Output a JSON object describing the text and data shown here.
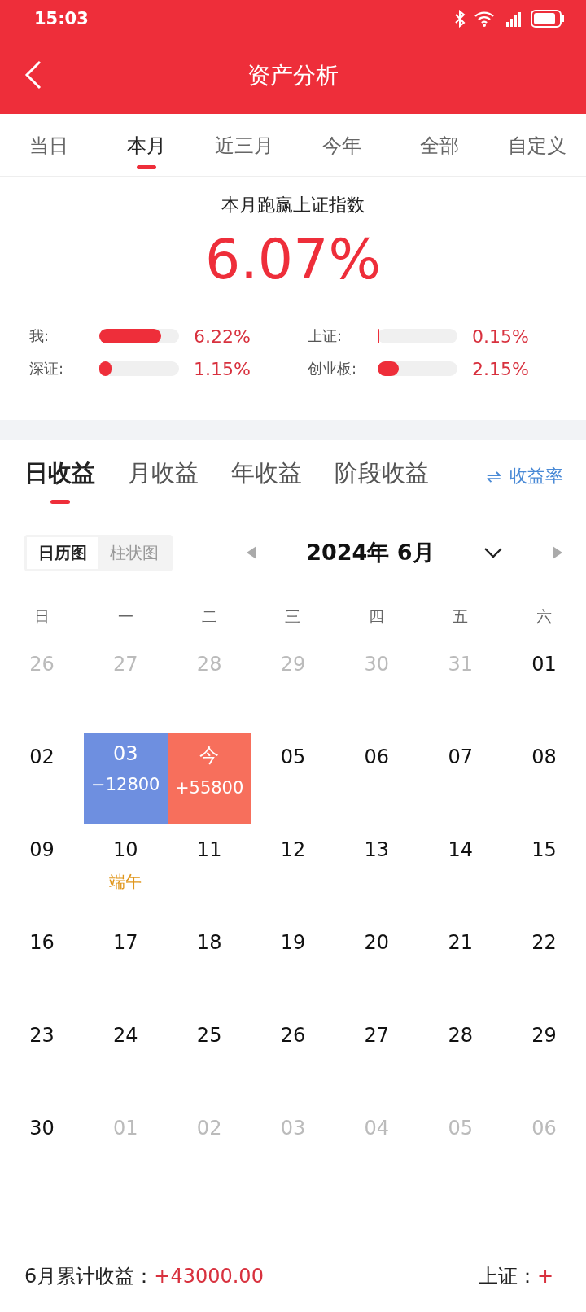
{
  "status_bar": {
    "time": "15:03"
  },
  "header": {
    "title": "资产分析"
  },
  "period_tabs": [
    {
      "label": "当日",
      "selected": false
    },
    {
      "label": "本月",
      "selected": true
    },
    {
      "label": "近三月",
      "selected": false
    },
    {
      "label": "今年",
      "selected": false
    },
    {
      "label": "全部",
      "selected": false
    },
    {
      "label": "自定义",
      "selected": false
    }
  ],
  "summary": {
    "title": "本月跑赢上证指数",
    "value": "6.07%",
    "bars": [
      {
        "label": "我:",
        "level": 0.78,
        "reading": "6.22%"
      },
      {
        "label": "上证:",
        "level": 0.02,
        "reading": "0.15%"
      },
      {
        "label": "深证:",
        "level": 0.15,
        "reading": "1.15%"
      },
      {
        "label": "创业板:",
        "level": 0.27,
        "reading": "2.15%"
      }
    ]
  },
  "profit_tabs": [
    {
      "label": "日收益",
      "selected": true
    },
    {
      "label": "月收益",
      "selected": false
    },
    {
      "label": "年收益",
      "selected": false
    },
    {
      "label": "阶段收益",
      "selected": false
    }
  ],
  "rate_toggle": {
    "icon": "⇌",
    "label": "收益率"
  },
  "view_toggle": [
    {
      "label": "日历图",
      "selected": true
    },
    {
      "label": "柱状图",
      "selected": false
    }
  ],
  "month": {
    "label": "2024年 6月"
  },
  "weekdays": [
    "日",
    "一",
    "二",
    "三",
    "四",
    "五",
    "六"
  ],
  "weeks": [
    [
      {
        "day": "26",
        "in_month": false
      },
      {
        "day": "27",
        "in_month": false
      },
      {
        "day": "28",
        "in_month": false
      },
      {
        "day": "29",
        "in_month": false
      },
      {
        "day": "30",
        "in_month": false
      },
      {
        "day": "31",
        "in_month": false
      },
      {
        "day": "01",
        "in_month": true
      }
    ],
    [
      {
        "day": "02",
        "in_month": true
      },
      {
        "day": "03",
        "amount": "−12800",
        "color": "#6e8fe0"
      },
      {
        "day": "今",
        "amount": "+55800",
        "color": "#f76f5c"
      },
      {
        "day": "05",
        "in_month": true
      },
      {
        "day": "06",
        "in_month": true
      },
      {
        "day": "07",
        "in_month": true
      },
      {
        "day": "08",
        "in_month": true
      }
    ],
    [
      {
        "day": "09",
        "in_month": true
      },
      {
        "day": "10",
        "in_month": true,
        "note": "端午"
      },
      {
        "day": "11",
        "in_month": true
      },
      {
        "day": "12",
        "in_month": true
      },
      {
        "day": "13",
        "in_month": true
      },
      {
        "day": "14",
        "in_month": true
      },
      {
        "day": "15",
        "in_month": true
      }
    ],
    [
      {
        "day": "16",
        "in_month": true
      },
      {
        "day": "17",
        "in_month": true
      },
      {
        "day": "18",
        "in_month": true
      },
      {
        "day": "19",
        "in_month": true
      },
      {
        "day": "20",
        "in_month": true
      },
      {
        "day": "21",
        "in_month": true
      },
      {
        "day": "22",
        "in_month": true
      }
    ],
    [
      {
        "day": "23",
        "in_month": true
      },
      {
        "day": "24",
        "in_month": true
      },
      {
        "day": "25",
        "in_month": true
      },
      {
        "day": "26",
        "in_month": true
      },
      {
        "day": "27",
        "in_month": true
      },
      {
        "day": "28",
        "in_month": true
      },
      {
        "day": "29",
        "in_month": true
      }
    ],
    [
      {
        "day": "30",
        "in_month": true
      },
      {
        "day": "01",
        "in_month": false
      },
      {
        "day": "02",
        "in_month": false
      },
      {
        "day": "03",
        "in_month": false
      },
      {
        "day": "04",
        "in_month": false
      },
      {
        "day": "05",
        "in_month": false
      },
      {
        "day": "06",
        "in_month": false
      }
    ]
  ],
  "footer": {
    "label": "6月累计收益：",
    "value": "+43000.00",
    "index_label": "上证：",
    "index_value": "+"
  }
}
